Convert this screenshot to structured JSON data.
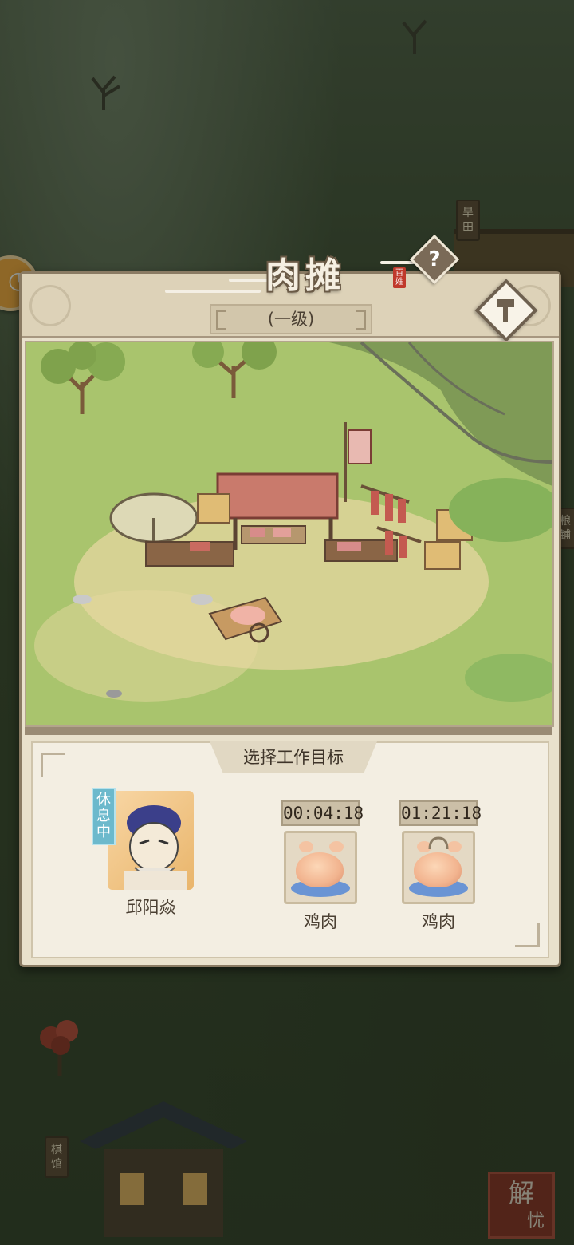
{
  "map": {
    "signs": [
      "旱田",
      "粮铺",
      "棋馆"
    ],
    "seal_text": [
      "解",
      "忧"
    ]
  },
  "panel": {
    "title": "肉摊",
    "title_tag": "百姓",
    "level": "(一级)",
    "help_symbol": "?",
    "work_title": "选择工作目标",
    "worker": {
      "status": "休息中",
      "name": "邱阳焱"
    },
    "targets": [
      {
        "timer": "00:04:18",
        "name": "鸡肉"
      },
      {
        "timer": "01:21:18",
        "name": "鸡肉"
      }
    ]
  }
}
